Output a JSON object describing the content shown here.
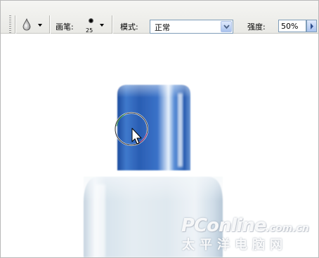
{
  "toolbar": {
    "tool_icon": "water-drop-icon",
    "brush_label": "画笔:",
    "brush_size": "25",
    "mode_label": "模式:",
    "mode_value": "正常",
    "strength_label": "强度:",
    "strength_value": "50%"
  },
  "canvas": {
    "cap_color": "#2f62b4",
    "body_color": "#dbe6ee",
    "cursor_ring_icon": "brush-circle-cursor-icon",
    "pointer_icon": "arrow-pointer-icon"
  },
  "watermark": {
    "logo_main": "PConline",
    "logo_suffix": ".com.cn",
    "logo_sub": "太平洋电脑网"
  }
}
